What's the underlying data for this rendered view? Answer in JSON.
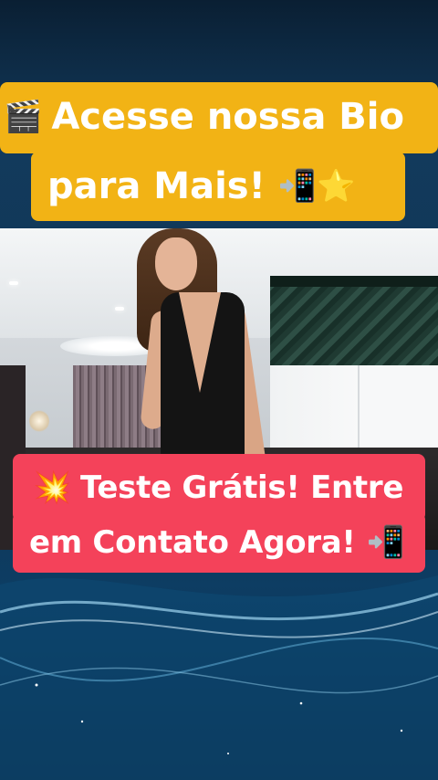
{
  "top_caption": {
    "line1": {
      "icon": "clapperboard-icon",
      "glyph": "🎬",
      "text": "Acesse nossa Bio"
    },
    "line2": {
      "text": "para Mais!",
      "trailing_icons": [
        "phone-arrow-icon",
        "star-icon"
      ],
      "trailing_glyphs": "📲⭐"
    }
  },
  "bottom_caption": {
    "line1": {
      "icon": "collision-icon",
      "glyph": "💥",
      "text": "Teste Grátis! Entre"
    },
    "line2": {
      "text": "em Contato Agora!",
      "trailing_icon": "phone-arrow-icon",
      "trailing_glyph": "📲"
    }
  },
  "colors": {
    "top_banner": "#f2b315",
    "bottom_banner": "#f4425a",
    "background": "#0b2a44"
  }
}
